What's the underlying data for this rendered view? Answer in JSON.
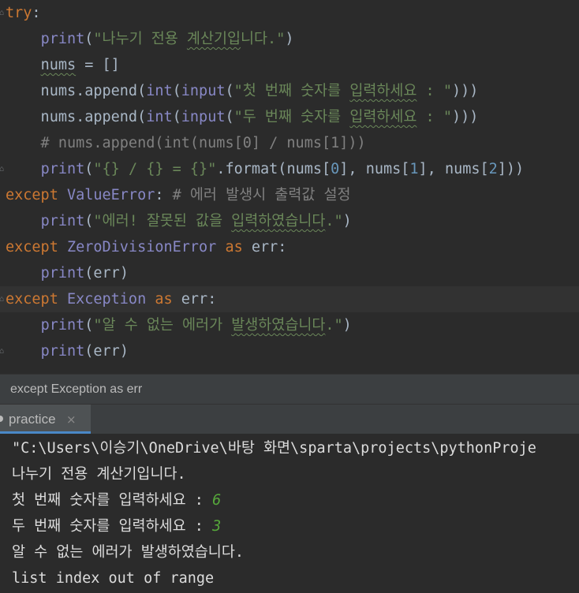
{
  "editor": {
    "lines": [
      {
        "id": "l1",
        "tokens": [
          {
            "t": "try",
            "c": "kw"
          },
          {
            "t": ":",
            "c": "op"
          }
        ]
      },
      {
        "id": "l2",
        "tokens": [
          {
            "t": "    "
          },
          {
            "t": "print",
            "c": "bi"
          },
          {
            "t": "("
          },
          {
            "t": "\"나누기 전용 ",
            "c": "str"
          },
          {
            "t": "계산기입",
            "c": "str typo"
          },
          {
            "t": "니다.\"",
            "c": "str"
          },
          {
            "t": ")"
          }
        ]
      },
      {
        "id": "l3",
        "tokens": [
          {
            "t": "    "
          },
          {
            "t": "nums",
            "c": "typo-plain"
          },
          {
            "t": " = []"
          }
        ]
      },
      {
        "id": "l4",
        "tokens": [
          {
            "t": "    nums.append("
          },
          {
            "t": "int",
            "c": "bi"
          },
          {
            "t": "("
          },
          {
            "t": "input",
            "c": "bi"
          },
          {
            "t": "("
          },
          {
            "t": "\"첫 번째 숫자를 ",
            "c": "str"
          },
          {
            "t": "입력하세요",
            "c": "str typo"
          },
          {
            "t": " : \"",
            "c": "str"
          },
          {
            "t": ")))"
          }
        ]
      },
      {
        "id": "l5",
        "tokens": [
          {
            "t": "    nums.append("
          },
          {
            "t": "int",
            "c": "bi"
          },
          {
            "t": "("
          },
          {
            "t": "input",
            "c": "bi"
          },
          {
            "t": "("
          },
          {
            "t": "\"두 번째 숫자를 ",
            "c": "str"
          },
          {
            "t": "입력하세요",
            "c": "str typo"
          },
          {
            "t": " : \"",
            "c": "str"
          },
          {
            "t": ")))"
          }
        ]
      },
      {
        "id": "l6",
        "tokens": [
          {
            "t": "    # nums.append(int(nums[0] / nums[1]))",
            "c": "cmt"
          }
        ]
      },
      {
        "id": "l7",
        "tokens": [
          {
            "t": "    "
          },
          {
            "t": "print",
            "c": "bi"
          },
          {
            "t": "("
          },
          {
            "t": "\"{} / {} = {}\"",
            "c": "str"
          },
          {
            "t": ".format(nums["
          },
          {
            "t": "0",
            "c": "num"
          },
          {
            "t": "], nums["
          },
          {
            "t": "1",
            "c": "num"
          },
          {
            "t": "], nums["
          },
          {
            "t": "2",
            "c": "num"
          },
          {
            "t": "]))"
          }
        ]
      },
      {
        "id": "l8",
        "tokens": [
          {
            "t": "except ",
            "c": "kw"
          },
          {
            "t": "ValueError",
            "c": "cls"
          },
          {
            "t": ":"
          },
          {
            "t": " "
          },
          {
            "t": "# 에러 발생시 출력값 설정",
            "c": "cmt"
          }
        ]
      },
      {
        "id": "l9",
        "tokens": [
          {
            "t": "    "
          },
          {
            "t": "print",
            "c": "bi"
          },
          {
            "t": "("
          },
          {
            "t": "\"에러! 잘못된 값을 ",
            "c": "str"
          },
          {
            "t": "입력하였습니다",
            "c": "str typo"
          },
          {
            "t": ".\"",
            "c": "str"
          },
          {
            "t": ")"
          }
        ]
      },
      {
        "id": "l10",
        "tokens": [
          {
            "t": "except ",
            "c": "kw"
          },
          {
            "t": "ZeroDivisionError",
            "c": "cls"
          },
          {
            "t": " as",
            "c": "kw"
          },
          {
            "t": " err:"
          }
        ]
      },
      {
        "id": "l11",
        "tokens": [
          {
            "t": "    "
          },
          {
            "t": "print",
            "c": "bi"
          },
          {
            "t": "(err)"
          }
        ]
      },
      {
        "id": "l12",
        "tokens": [
          {
            "t": "except ",
            "c": "kw"
          },
          {
            "t": "Exception",
            "c": "cls"
          },
          {
            "t": " as",
            "c": "kw"
          },
          {
            "t": " err:"
          }
        ]
      },
      {
        "id": "l13",
        "tokens": [
          {
            "t": "    "
          },
          {
            "t": "print",
            "c": "bi"
          },
          {
            "t": "("
          },
          {
            "t": "\"알 수 없는 에러가 ",
            "c": "str"
          },
          {
            "t": "발생하였습니다",
            "c": "str typo"
          },
          {
            "t": ".\"",
            "c": "str"
          },
          {
            "t": ")"
          }
        ]
      },
      {
        "id": "l14",
        "tokens": [
          {
            "t": "    "
          },
          {
            "t": "print",
            "c": "bi"
          },
          {
            "t": "(err)"
          }
        ]
      }
    ]
  },
  "breadcrumb": {
    "text": "except Exception as err"
  },
  "run_panel": {
    "tab_label": "practice",
    "close_glyph": "×"
  },
  "console": {
    "path_line": "\"C:\\Users\\이승기\\OneDrive\\바탕 화면\\sparta\\projects\\pythonProje",
    "line1": "나누기 전용 계산기입니다.",
    "prompt1": "첫 번째 숫자를 입력하세요 : ",
    "input1": "6",
    "prompt2": "두 번째 숫자를 입력하세요 : ",
    "input2": "3",
    "line4": "알 수 없는 에러가 발생하였습니다.",
    "line5": "list index out of range"
  },
  "colors": {
    "background": "#2b2b2b",
    "keyword": "#cc7832",
    "builtin": "#8888c6",
    "string": "#6a8759",
    "number": "#6897bb",
    "comment": "#808080",
    "console_input": "#56a83b",
    "tab_accent": "#4a88c7"
  }
}
